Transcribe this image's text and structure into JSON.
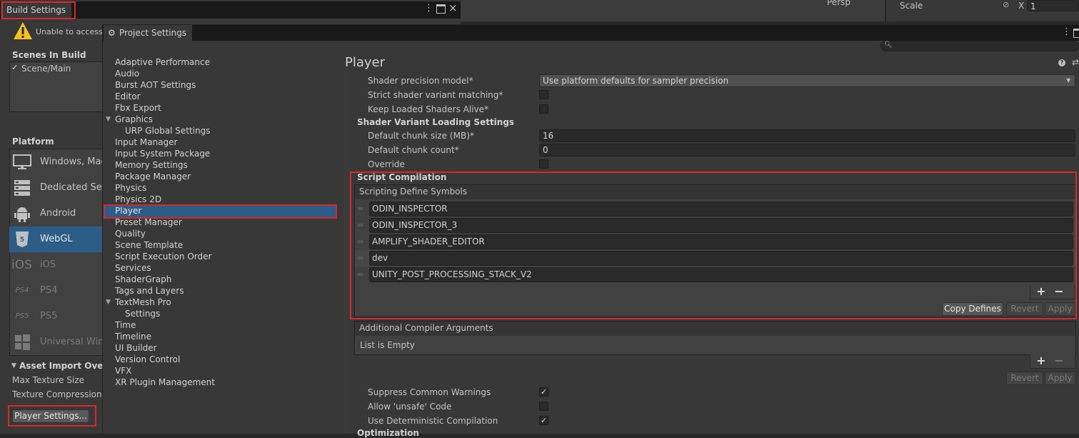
{
  "scene_header": {
    "persp": "Persp"
  },
  "inspector_header": {
    "scale_label": "Scale",
    "x_label": "X",
    "x_value": "1"
  },
  "build_settings": {
    "tab": "Build Settings",
    "warning": "Unable to access U",
    "scenes_header": "Scenes In Build",
    "scenes": [
      "Scene/Main"
    ],
    "platform_header": "Platform",
    "platforms": [
      {
        "icon": "monitor-icon",
        "label": "Windows, Mac"
      },
      {
        "icon": "server-icon",
        "label": "Dedicated Ser"
      },
      {
        "icon": "android-icon",
        "label": "Android"
      },
      {
        "icon": "html5-icon",
        "label": "WebGL"
      },
      {
        "icon": "ios-icon",
        "label": "iOS"
      },
      {
        "icon": "ps4-icon",
        "label": "PS4"
      },
      {
        "icon": "ps5-icon",
        "label": "PS5"
      },
      {
        "icon": "windows-icon",
        "label": "Universal Wind"
      }
    ],
    "icon_text": {
      "ios": "iOS",
      "ps4": "PS4",
      "ps5": "PS5",
      "html5": "HTML 5"
    },
    "asset_import_header": "Asset Import Overri",
    "max_texture_size": "Max Texture Size",
    "texture_compression": "Texture Compression",
    "player_settings_button": "Player Settings..."
  },
  "project_settings": {
    "tab": "Project Settings",
    "categories": [
      {
        "label": "Adaptive Performance",
        "indent": 0
      },
      {
        "label": "Audio",
        "indent": 0
      },
      {
        "label": "Burst AOT Settings",
        "indent": 0
      },
      {
        "label": "Editor",
        "indent": 0
      },
      {
        "label": "Fbx Export",
        "indent": 0
      },
      {
        "label": "Graphics",
        "indent": 0,
        "expanded": true
      },
      {
        "label": "URP Global Settings",
        "indent": 1
      },
      {
        "label": "Input Manager",
        "indent": 0
      },
      {
        "label": "Input System Package",
        "indent": 0
      },
      {
        "label": "Memory Settings",
        "indent": 0
      },
      {
        "label": "Package Manager",
        "indent": 0
      },
      {
        "label": "Physics",
        "indent": 0
      },
      {
        "label": "Physics 2D",
        "indent": 0
      },
      {
        "label": "Player",
        "indent": 0,
        "selected": true
      },
      {
        "label": "Preset Manager",
        "indent": 0
      },
      {
        "label": "Quality",
        "indent": 0
      },
      {
        "label": "Scene Template",
        "indent": 0
      },
      {
        "label": "Script Execution Order",
        "indent": 0
      },
      {
        "label": "Services",
        "indent": 0
      },
      {
        "label": "ShaderGraph",
        "indent": 0
      },
      {
        "label": "Tags and Layers",
        "indent": 0
      },
      {
        "label": "TextMesh Pro",
        "indent": 0,
        "expanded": true
      },
      {
        "label": "Settings",
        "indent": 1
      },
      {
        "label": "Time",
        "indent": 0
      },
      {
        "label": "Timeline",
        "indent": 0
      },
      {
        "label": "UI Builder",
        "indent": 0
      },
      {
        "label": "Version Control",
        "indent": 0
      },
      {
        "label": "VFX",
        "indent": 0
      },
      {
        "label": "XR Plugin Management",
        "indent": 0
      }
    ],
    "player": {
      "title": "Player",
      "shader_precision_label": "Shader precision model*",
      "shader_precision_value": "Use platform defaults for sampler precision",
      "strict_shader_label": "Strict shader variant matching*",
      "keep_shaders_label": "Keep Loaded Shaders Alive*",
      "variant_loading_header": "Shader Variant Loading Settings",
      "chunk_size_label": "Default chunk size (MB)*",
      "chunk_size_value": "16",
      "chunk_count_label": "Default chunk count*",
      "chunk_count_value": "0",
      "override_label": "Override",
      "script_compilation_header": "Script Compilation",
      "scripting_define_header": "Scripting Define Symbols",
      "defines": [
        "ODIN_INSPECTOR",
        "ODIN_INSPECTOR_3",
        "AMPLIFY_SHADER_EDITOR",
        "dev",
        "UNITY_POST_PROCESSING_STACK_V2"
      ],
      "plus": "+",
      "minus": "−",
      "copy_defines": "Copy Defines",
      "revert": "Revert",
      "apply": "Apply",
      "additional_args_header": "Additional Compiler Arguments",
      "list_empty": "List is Empty",
      "suppress_warnings_label": "Suppress Common Warnings",
      "allow_unsafe_label": "Allow 'unsafe' Code",
      "deterministic_label": "Use Deterministic Compilation",
      "optimization_header": "Optimization",
      "check": "✓"
    }
  }
}
